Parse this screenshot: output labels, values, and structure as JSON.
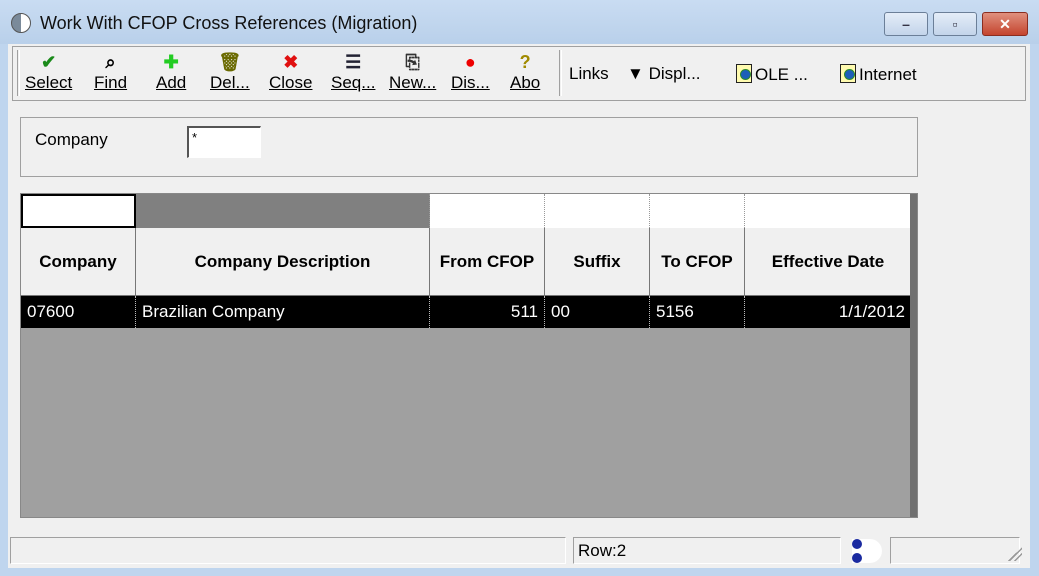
{
  "window": {
    "title": "Work With CFOP Cross References (Migration)",
    "minimize": "–",
    "maximize": "▫",
    "close": "✕"
  },
  "toolbar": {
    "buttons": [
      {
        "label": "Select",
        "icon": "✔",
        "color": "#1a8a1a"
      },
      {
        "label": "Find",
        "icon": "⌕",
        "color": "#000"
      },
      {
        "label": "Add",
        "icon": "✚",
        "color": "#22cc22"
      },
      {
        "label": "Del...",
        "icon": "🗑",
        "color": "#6a6a00"
      },
      {
        "label": "Close",
        "icon": "✖",
        "color": "#e01010"
      },
      {
        "label": "Seq...",
        "icon": "☰",
        "color": "#223"
      },
      {
        "label": "New...",
        "icon": "⎘",
        "color": "#333"
      },
      {
        "label": "Dis...",
        "icon": "●",
        "color": "#ee0000"
      },
      {
        "label": "Abo",
        "icon": "?",
        "color": "#a08a00"
      }
    ],
    "links": "Links",
    "display": "Displ...",
    "ole": "OLE ...",
    "internet": "Internet"
  },
  "filter": {
    "company_label": "Company",
    "company_value": "*"
  },
  "grid": {
    "columns": [
      "Company",
      "Company Description",
      "From CFOP",
      "Suffix",
      "To CFOP",
      "Effective Date"
    ],
    "rows": [
      [
        "07600",
        "Brazilian Company",
        "511",
        "00",
        "5156",
        "1/1/2012"
      ]
    ]
  },
  "status": {
    "row": "Row:2"
  }
}
